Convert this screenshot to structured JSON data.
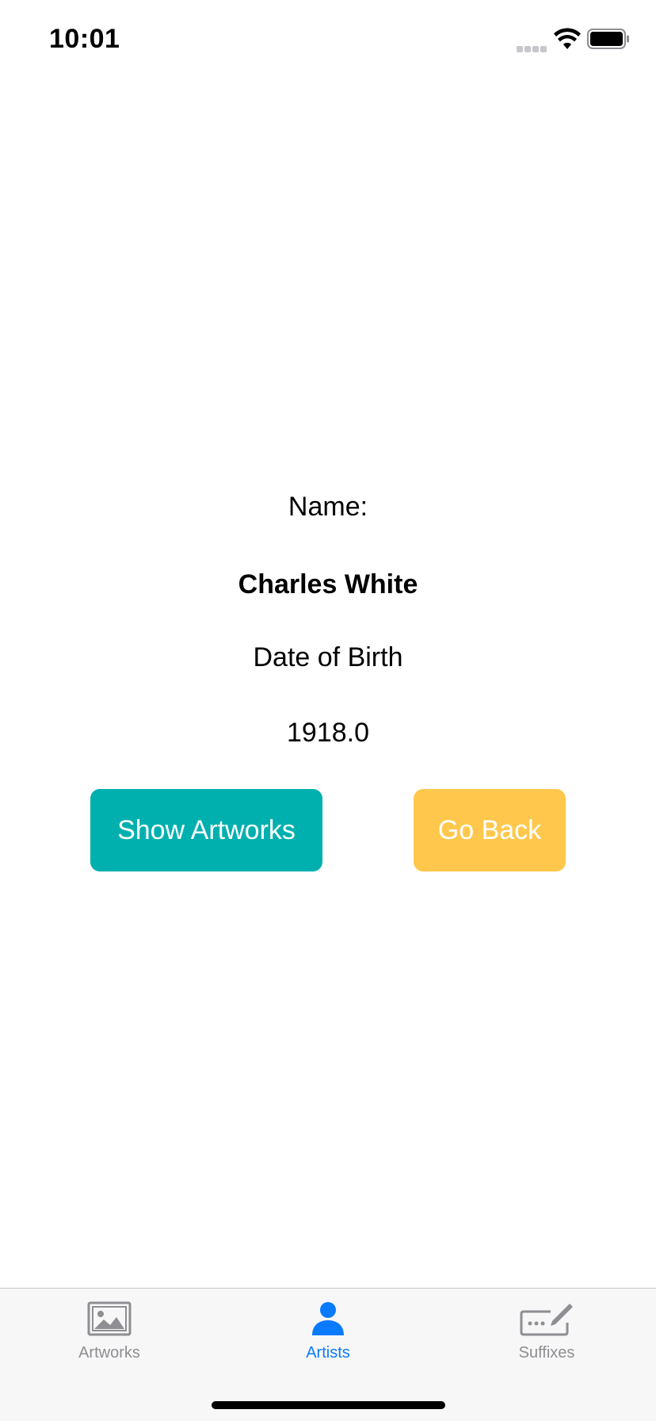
{
  "status_bar": {
    "time": "10:01"
  },
  "artist": {
    "name_label": "Name:",
    "name_value": "Charles White",
    "dob_label": "Date of Birth",
    "dob_value": "1918.0"
  },
  "buttons": {
    "show_artworks": "Show Artworks",
    "go_back": "Go Back"
  },
  "colors": {
    "show_artworks_bg": "#00b0af",
    "go_back_bg": "#ffc84d",
    "tab_active": "#0a7aff",
    "tab_inactive": "#8e8e93"
  },
  "tab_bar": {
    "active": "Artists",
    "tabs": [
      {
        "label": "Artworks",
        "icon": "photo-icon"
      },
      {
        "label": "Artists",
        "icon": "person-icon"
      },
      {
        "label": "Suffixes",
        "icon": "keyboard-pencil-icon"
      }
    ]
  }
}
